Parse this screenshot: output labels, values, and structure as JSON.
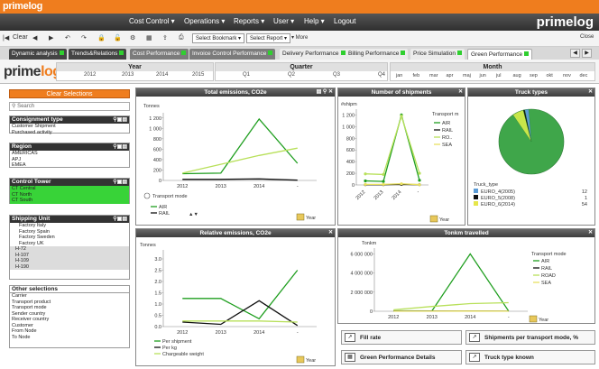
{
  "brand": {
    "logo": "primelog",
    "logo_big_a": "prime",
    "logo_big_b": "log",
    "accent": "#ef7d1e"
  },
  "menu": [
    "Cost Control ▾",
    "Operations ▾",
    "Reports ▾",
    "User ▾",
    "Help ▾",
    "Logout"
  ],
  "toolbar": {
    "clear": "Clear",
    "select_bookmark": "Select Bookmark ▾",
    "select_report": "Select Report ▾",
    "more": "▾ More",
    "close": "Close"
  },
  "tabs": [
    "Dynamic analysis",
    "Trends&Relations",
    "Cost Performance",
    "Invoice Control Performance",
    "Delivery Performance",
    "Billing Performance",
    "Price Simulation",
    "Green Performance"
  ],
  "time": {
    "year_label": "Year",
    "years": [
      "2012",
      "2013",
      "2014",
      "2015"
    ],
    "quarter_label": "Quarter",
    "quarters": [
      "Q1",
      "Q2",
      "Q3",
      "Q4"
    ],
    "month_label": "Month",
    "months": [
      "jan",
      "feb",
      "mar",
      "apr",
      "maj",
      "jun",
      "jul",
      "aug",
      "sep",
      "okt",
      "nov",
      "dec"
    ]
  },
  "sidebar": {
    "clear_selections": "Clear Selections",
    "search_placeholder": "Search",
    "consignment": {
      "title": "Consignment type",
      "items": [
        "Customer Shipment",
        "Purchased activity"
      ]
    },
    "region": {
      "title": "Region",
      "items": [
        "AMERICAS",
        "APJ",
        "EMEA"
      ]
    },
    "tower": {
      "title": "Control Tower",
      "items": [
        "CT Central",
        "CT North",
        "CT South"
      ]
    },
    "shipping": {
      "title": "Shipping Unit",
      "items": [
        "Factory Italy",
        "Factory Spain",
        "Factory Sweden",
        "Factory UK",
        "H-72",
        "H-107",
        "H-109",
        "H-190"
      ]
    },
    "other": {
      "title": "Other selections",
      "items": [
        "Carrier",
        "Transport product",
        "Transport mode",
        "Sender country",
        "Receiver country",
        "Customer",
        "From Node",
        "To Node"
      ]
    }
  },
  "charts": {
    "total": {
      "title": "Total emissions, CO2e",
      "unit": "Tonnes",
      "legend_title": "Transport mode",
      "year_label": "Year"
    },
    "shipments": {
      "title": "Number of shipments",
      "unit": "#shipm",
      "legend_title": "Transport m",
      "year_label": "Year"
    },
    "trucks": {
      "title": "Truck types",
      "legend_title": "Truck_type"
    },
    "relative": {
      "title": "Relative emissions, CO2e",
      "unit": "Tonnes",
      "year_label": "Year"
    },
    "tonkm": {
      "title": "Tonkm travelled",
      "unit": "Tonkm",
      "legend_title": "Transport mode",
      "year_label": "Year"
    }
  },
  "buttons": {
    "fill_rate": "Fill rate",
    "shipments_per_mode": "Shipments per transport mode, %",
    "green_details": "Green Performance Details",
    "truck_known": "Truck type known"
  },
  "chart_data": [
    {
      "type": "line",
      "title": "Total emissions, CO2e",
      "ylabel": "Tonnes",
      "xlabel": "Year",
      "categories": [
        "2012",
        "2013",
        "2014",
        "-"
      ],
      "ylim": [
        0,
        1300
      ],
      "yticks": [
        "0",
        "200",
        "400",
        "600",
        "800",
        "1 000",
        "1 200"
      ],
      "series": [
        {
          "name": "AIR",
          "color": "#1e9e1e",
          "values": [
            130,
            140,
            1180,
            330
          ]
        },
        {
          "name": "RAIL",
          "color": "#111111",
          "values": [
            20,
            20,
            30,
            5
          ]
        },
        {
          "color": "#b8e05a",
          "values": [
            140,
            310,
            480,
            620
          ]
        }
      ]
    },
    {
      "type": "line",
      "title": "Number of shipments",
      "ylabel": "#shipm",
      "xlabel": "Year",
      "categories": [
        "2012",
        "2013",
        "2014",
        "-"
      ],
      "ylim": [
        0,
        1300
      ],
      "yticks": [
        "0",
        "200",
        "400",
        "600",
        "800",
        "1 000",
        "1 200"
      ],
      "series": [
        {
          "name": "AIR",
          "color": "#1e9e1e",
          "values": [
            70,
            60,
            1200,
            80
          ]
        },
        {
          "name": "RAIL",
          "color": "#111111",
          "values": [
            5,
            5,
            10,
            5
          ]
        },
        {
          "name": "RO..",
          "color": "#b8e05a",
          "values": [
            190,
            180,
            1180,
            200
          ]
        },
        {
          "name": "SEA",
          "color": "#e8e060",
          "values": [
            10,
            10,
            20,
            5
          ]
        }
      ]
    },
    {
      "type": "pie",
      "title": "Truck types",
      "categories": [
        "EURO_4(2005)",
        "EURO_5(2008)",
        "EURO_6(2014)"
      ],
      "values": [
        12,
        1,
        54
      ],
      "colors": [
        "#5b9bd5",
        "#111111",
        "#e6e64a"
      ]
    },
    {
      "type": "line",
      "title": "Relative emissions, CO2e",
      "ylabel": "Tonnes",
      "categories": [
        "2012",
        "2013",
        "2014",
        "-"
      ],
      "ylim": [
        0,
        3.4
      ],
      "yticks": [
        "0.0",
        "0.5",
        "1.0",
        "1.5",
        "2.0",
        "2.5",
        "3.0"
      ],
      "series": [
        {
          "name": "Per shipment",
          "color": "#1e9e1e",
          "values": [
            1.25,
            1.25,
            0.35,
            2.5
          ]
        },
        {
          "name": "Per kg",
          "color": "#111111",
          "values": [
            0.2,
            0.1,
            1.15,
            0.05
          ]
        },
        {
          "name": "Chargeable weight",
          "color": "#b8e05a",
          "values": [
            0.25,
            0.25,
            0.25,
            0.2
          ]
        }
      ]
    },
    {
      "type": "line",
      "title": "Tonkm travelled",
      "ylabel": "Tonkm",
      "xlabel": "Year",
      "categories": [
        "2012",
        "2013",
        "2014",
        "-"
      ],
      "ylim": [
        0,
        6600000
      ],
      "yticks": [
        "0",
        "2 000 000",
        "4 000 000",
        "6 000 000"
      ],
      "series": [
        {
          "name": "AIR",
          "color": "#1e9e1e",
          "values": [
            50000,
            30000,
            6000000,
            30000
          ]
        },
        {
          "name": "RAIL",
          "color": "#111111",
          "values": [
            20000,
            20000,
            40000,
            10000
          ]
        },
        {
          "name": "ROAD",
          "color": "#b8e05a",
          "values": [
            150000,
            500000,
            800000,
            900000
          ]
        },
        {
          "name": "SEA",
          "color": "#e8e060",
          "values": [
            10000,
            10000,
            20000,
            10000
          ]
        }
      ]
    }
  ]
}
